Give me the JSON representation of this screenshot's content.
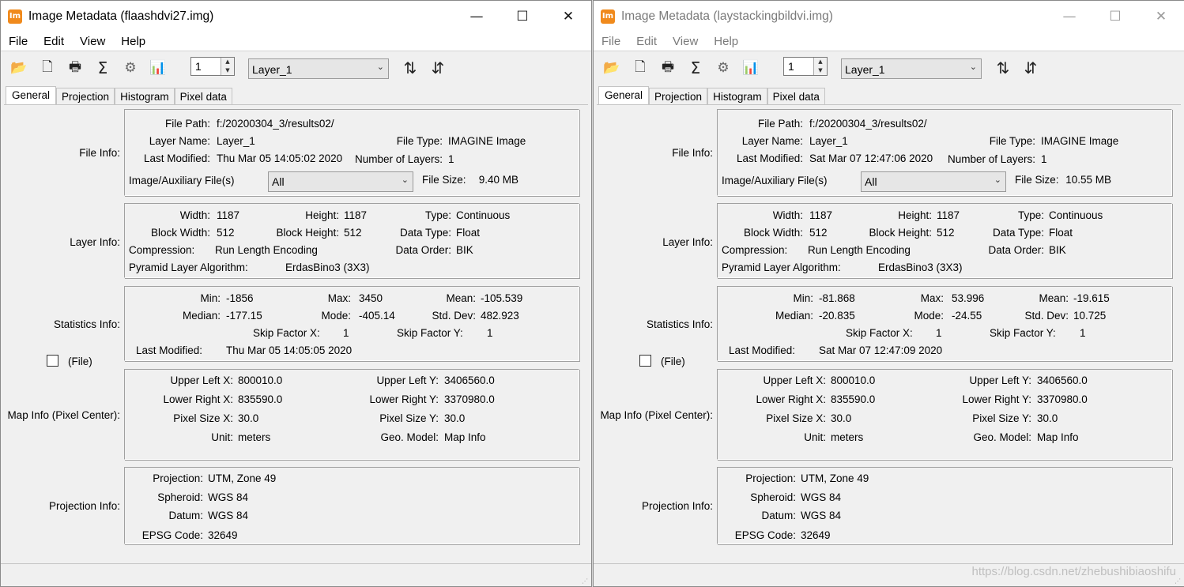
{
  "windows": [
    {
      "active": true,
      "app_icon_text": "Im",
      "title": "Image Metadata (flaashdvi27.img)",
      "caption": {
        "minimize": "—",
        "maximize": "☐",
        "close": "✕"
      },
      "menu": [
        "File",
        "Edit",
        "View",
        "Help"
      ],
      "toolbar": {
        "icons": [
          "open-folder-icon",
          "new-file-icon",
          "print-icon",
          "sigma-icon",
          "gear-icon",
          "histogram-icon"
        ],
        "glyphs": [
          "📂",
          "🗋",
          "🖶",
          "Σ",
          "⚙",
          "📊"
        ],
        "layer_number": "1",
        "layer_select": "Layer_1",
        "sort_up": "⇅",
        "sort_down": "⇵"
      },
      "tabs": [
        "General",
        "Projection",
        "Histogram",
        "Pixel data"
      ],
      "file_info": {
        "group_label": "File Info:",
        "file_path_label": "File Path:",
        "file_path": "f:/20200304_3/results02/",
        "layer_name_label": "Layer Name:",
        "layer_name": "Layer_1",
        "file_type_label": "File Type:",
        "file_type": "IMAGINE Image",
        "last_modified_label": "Last Modified:",
        "last_modified": "Thu Mar 05 14:05:02 2020",
        "num_layers_label": "Number of Layers:",
        "num_layers": "1",
        "aux_label": "Image/Auxiliary File(s)",
        "aux_select": "All",
        "file_size_label": "File Size:",
        "file_size": "9.40 MB"
      },
      "layer_info": {
        "group_label": "Layer Info:",
        "width_label": "Width:",
        "width": "1187",
        "height_label": "Height:",
        "height": "1187",
        "type_label": "Type:",
        "type": "Continuous",
        "block_width_label": "Block Width:",
        "block_width": "512",
        "block_height_label": "Block Height:",
        "block_height": "512",
        "data_type_label": "Data Type:",
        "data_type": "Float",
        "compression_label": "Compression:",
        "compression": "Run Length Encoding",
        "data_order_label": "Data Order:",
        "data_order": "BIK",
        "pyramid_label": "Pyramid Layer Algorithm:",
        "pyramid": "ErdasBino3 (3X3)"
      },
      "statistics_info": {
        "group_label": "Statistics Info:",
        "min_label": "Min:",
        "min": "-1856",
        "max_label": "Max:",
        "max": "3450",
        "mean_label": "Mean:",
        "mean": "-105.539",
        "median_label": "Median:",
        "median": "-177.15",
        "mode_label": "Mode:",
        "mode": "-405.14",
        "std_label": "Std. Dev:",
        "std": "482.923",
        "skip_x_label": "Skip Factor X:",
        "skip_x": "1",
        "skip_y_label": "Skip Factor Y:",
        "skip_y": "1",
        "last_modified_label": "Last Modified:",
        "last_modified": "Thu Mar 05 14:05:05 2020",
        "file_checkbox_label": "(File)"
      },
      "map_info": {
        "group_label": "Map Info (Pixel Center):",
        "ulx_label": "Upper Left X:",
        "ulx": "800010.0",
        "uly_label": "Upper Left Y:",
        "uly": "3406560.0",
        "lrx_label": "Lower Right X:",
        "lrx": "835590.0",
        "lry_label": "Lower Right Y:",
        "lry": "3370980.0",
        "psx_label": "Pixel Size X:",
        "psx": "30.0",
        "psy_label": "Pixel Size Y:",
        "psy": "30.0",
        "unit_label": "Unit:",
        "unit": "meters",
        "geo_label": "Geo. Model:",
        "geo": "Map Info"
      },
      "projection_info": {
        "group_label": "Projection Info:",
        "projection_label": "Projection:",
        "projection": "UTM, Zone 49",
        "spheroid_label": "Spheroid:",
        "spheroid": "WGS 84",
        "datum_label": "Datum:",
        "datum": "WGS 84",
        "epsg_label": "EPSG Code:",
        "epsg": "32649"
      }
    },
    {
      "active": false,
      "app_icon_text": "Im",
      "title": "Image Metadata (laystackingbildvi.img)",
      "caption": {
        "minimize": "—",
        "maximize": "☐",
        "close": "✕"
      },
      "menu": [
        "File",
        "Edit",
        "View",
        "Help"
      ],
      "toolbar": {
        "icons": [
          "open-folder-icon",
          "new-file-icon",
          "print-icon",
          "sigma-icon",
          "gear-icon",
          "histogram-icon"
        ],
        "glyphs": [
          "📂",
          "🗋",
          "🖶",
          "Σ",
          "⚙",
          "📊"
        ],
        "layer_number": "1",
        "layer_select": "Layer_1",
        "sort_up": "⇅",
        "sort_down": "⇵"
      },
      "tabs": [
        "General",
        "Projection",
        "Histogram",
        "Pixel data"
      ],
      "file_info": {
        "group_label": "File Info:",
        "file_path_label": "File Path:",
        "file_path": "f:/20200304_3/results02/",
        "layer_name_label": "Layer Name:",
        "layer_name": "Layer_1",
        "file_type_label": "File Type:",
        "file_type": "IMAGINE Image",
        "last_modified_label": "Last Modified:",
        "last_modified": "Sat Mar 07 12:47:06 2020",
        "num_layers_label": "Number of Layers:",
        "num_layers": "1",
        "aux_label": "Image/Auxiliary File(s)",
        "aux_select": "All",
        "file_size_label": "File Size:",
        "file_size": "10.55 MB"
      },
      "layer_info": {
        "group_label": "Layer Info:",
        "width_label": "Width:",
        "width": "1187",
        "height_label": "Height:",
        "height": "1187",
        "type_label": "Type:",
        "type": "Continuous",
        "block_width_label": "Block Width:",
        "block_width": "512",
        "block_height_label": "Block Height:",
        "block_height": "512",
        "data_type_label": "Data Type:",
        "data_type": "Float",
        "compression_label": "Compression:",
        "compression": "Run Length Encoding",
        "data_order_label": "Data Order:",
        "data_order": "BIK",
        "pyramid_label": "Pyramid Layer Algorithm:",
        "pyramid": "ErdasBino3 (3X3)"
      },
      "statistics_info": {
        "group_label": "Statistics Info:",
        "min_label": "Min:",
        "min": "-81.868",
        "max_label": "Max:",
        "max": "53.996",
        "mean_label": "Mean:",
        "mean": "-19.615",
        "median_label": "Median:",
        "median": "-20.835",
        "mode_label": "Mode:",
        "mode": "-24.55",
        "std_label": "Std. Dev:",
        "std": "10.725",
        "skip_x_label": "Skip Factor X:",
        "skip_x": "1",
        "skip_y_label": "Skip Factor Y:",
        "skip_y": "1",
        "last_modified_label": "Last Modified:",
        "last_modified": "Sat Mar 07 12:47:09 2020",
        "file_checkbox_label": "(File)"
      },
      "map_info": {
        "group_label": "Map Info (Pixel Center):",
        "ulx_label": "Upper Left X:",
        "ulx": "800010.0",
        "uly_label": "Upper Left Y:",
        "uly": "3406560.0",
        "lrx_label": "Lower Right X:",
        "lrx": "835590.0",
        "lry_label": "Lower Right Y:",
        "lry": "3370980.0",
        "psx_label": "Pixel Size X:",
        "psx": "30.0",
        "psy_label": "Pixel Size Y:",
        "psy": "30.0",
        "unit_label": "Unit:",
        "unit": "meters",
        "geo_label": "Geo. Model:",
        "geo": "Map Info"
      },
      "projection_info": {
        "group_label": "Projection Info:",
        "projection_label": "Projection:",
        "projection": "UTM, Zone 49",
        "spheroid_label": "Spheroid:",
        "spheroid": "WGS 84",
        "datum_label": "Datum:",
        "datum": "WGS 84",
        "epsg_label": "EPSG Code:",
        "epsg": "32649"
      }
    }
  ],
  "watermark": "https://blog.csdn.net/zhebushibiaoshifu"
}
